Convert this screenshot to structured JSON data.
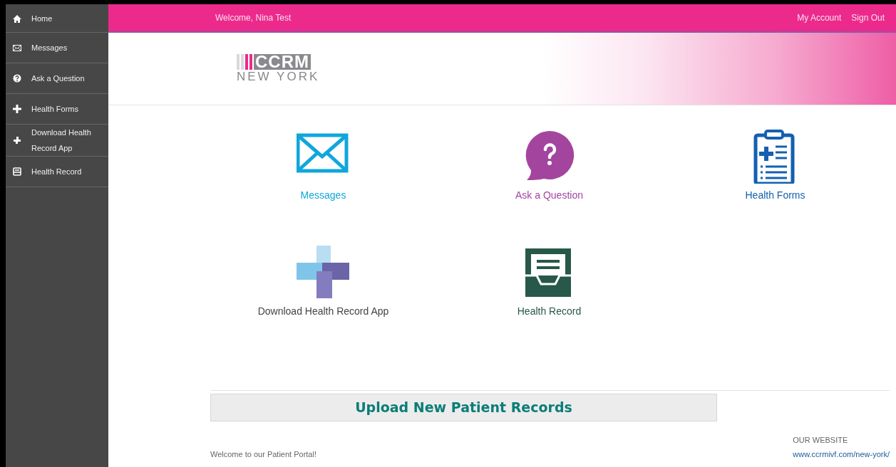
{
  "sidebar": {
    "items": [
      {
        "label": "Home"
      },
      {
        "label": "Messages"
      },
      {
        "label": "Ask a Question"
      },
      {
        "label": "Health Forms"
      },
      {
        "label": "Download Health Record App"
      },
      {
        "label": "Health Record"
      }
    ]
  },
  "topbar": {
    "welcome": "Welcome, Nina Test",
    "links": [
      "My Account",
      "Sign Out"
    ]
  },
  "logo": {
    "mark": "CCRM",
    "place": "NEW YORK"
  },
  "tiles": [
    {
      "label": "Messages",
      "color": "#0fa7db"
    },
    {
      "label": "Ask a Question",
      "color": "#a3459f"
    },
    {
      "label": "Health Forms",
      "color": "#1460b0"
    },
    {
      "label": "Download Health Record App",
      "color": "#444444"
    },
    {
      "label": "Health Record",
      "color": "#27584a"
    }
  ],
  "upload": {
    "label": "Upload New Patient Records"
  },
  "footer": {
    "welcome": "Welcome to our Patient Portal!",
    "website_heading": "OUR WEBSITE",
    "website_link": "www.ccrmivf.com/new-york/"
  }
}
